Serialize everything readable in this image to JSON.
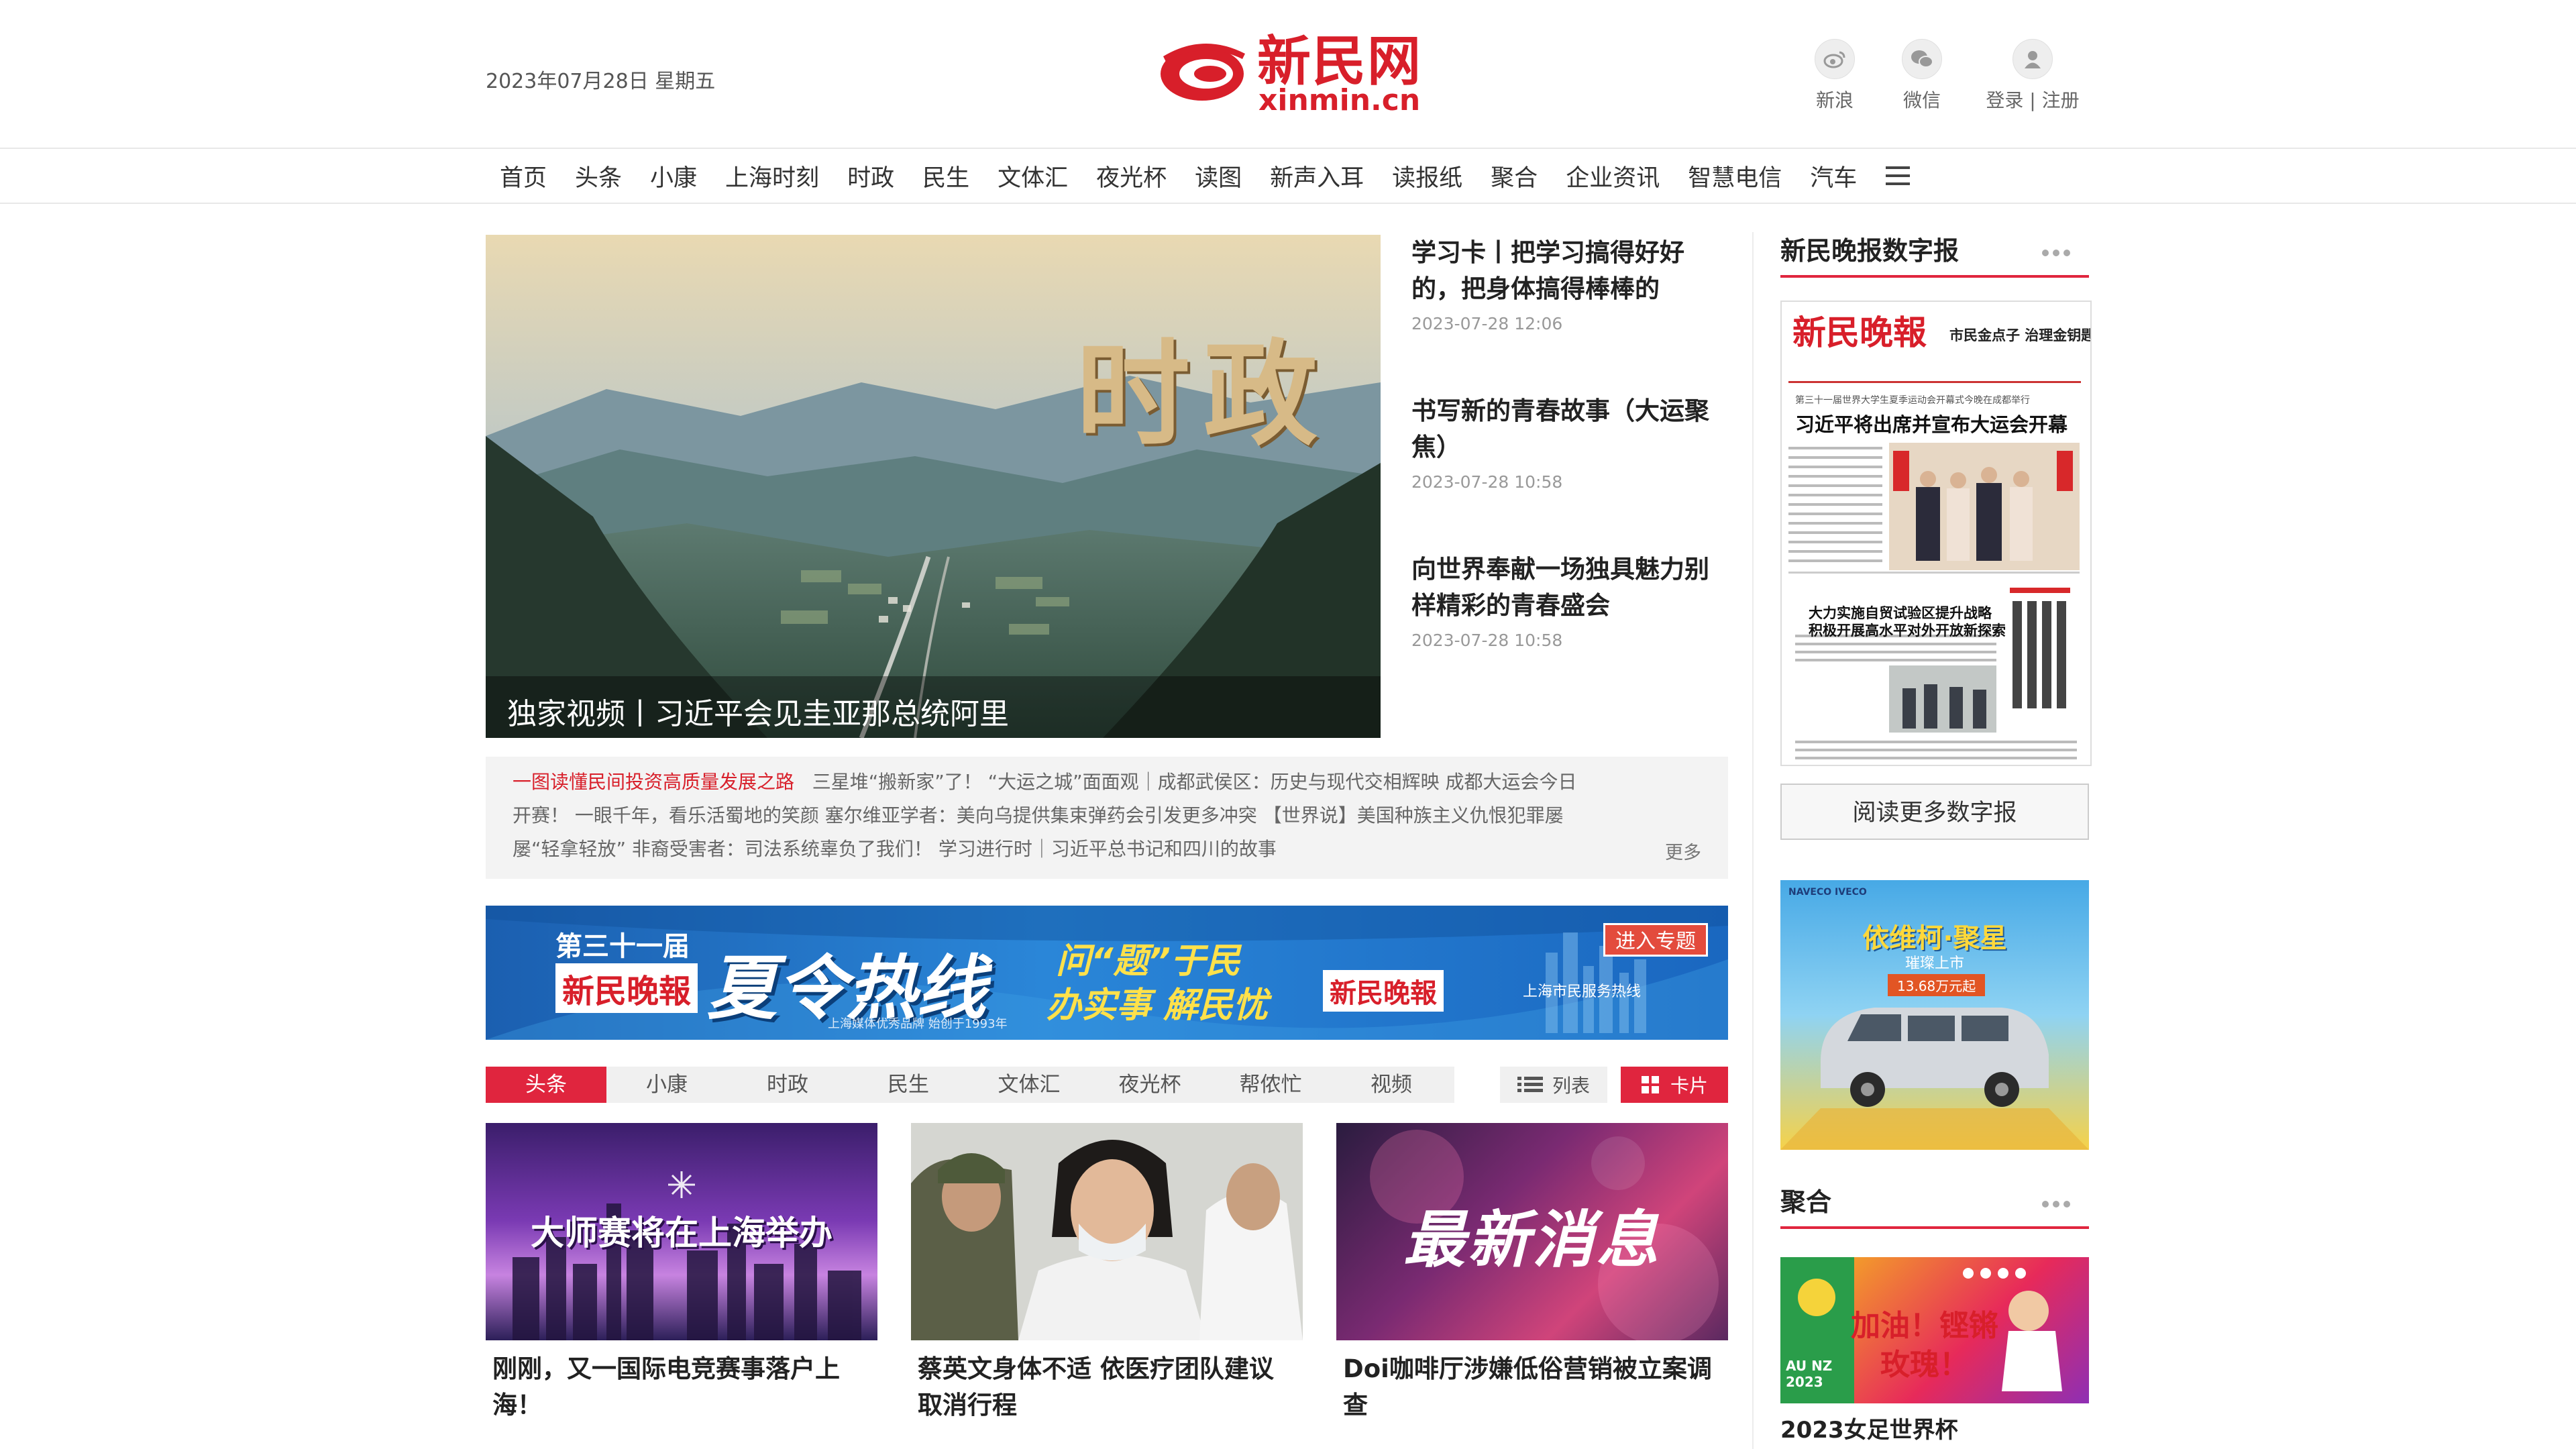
{
  "header": {
    "date": "2023年07月28日 星期五",
    "logo_cn": "新民网",
    "logo_en": "xinmin.cn",
    "tools": [
      {
        "icon": "weibo-icon",
        "label": "新浪"
      },
      {
        "icon": "wechat-icon",
        "label": "微信"
      },
      {
        "icon": "user-icon",
        "label": "登录 | 注册"
      }
    ]
  },
  "nav": [
    "首页",
    "头条",
    "小康",
    "上海时刻",
    "时政",
    "民生",
    "文体汇",
    "夜光杯",
    "读图",
    "新声入耳",
    "读报纸",
    "聚合",
    "企业资讯",
    "智慧电信",
    "汽车"
  ],
  "hero": {
    "overlay_text": "时政",
    "caption": "独家视频丨习近平会见圭亚那总统阿里"
  },
  "side_news": [
    {
      "title": "学习卡丨把学习搞得好好的，把身体搞得棒棒的",
      "date": "2023-07-28 12:06"
    },
    {
      "title": "书写新的青春故事（大运聚焦）",
      "date": "2023-07-28 10:58"
    },
    {
      "title": "向世界奉献一场独具魅力别样精彩的青春盛会",
      "date": "2023-07-28 10:58"
    }
  ],
  "ticker": {
    "highlight": "一图读懂民间投资高质量发展之路",
    "line1_rest": "三星堆“搬新家”了！  “大运之城”面面观｜成都武侯区：历史与现代交相辉映   成都大运会今日",
    "line2": "开赛！   一眼千年，看乐活蜀地的笑颜   塞尔维亚学者：美向乌提供集束弹药会引发更多冲突   【世界说】美国种族主义仇恨犯罪屡",
    "line3": "屡“轻拿轻放” 非裔受害者：司法系统辜负了我们！   学习进行时｜习近平总书记和四川的故事",
    "more": "更多"
  },
  "banner": {
    "edition": "第三十一届",
    "paper_name": "新民晚報",
    "title": "夏令热线",
    "slogan_top": "问“题”于民",
    "slogan_bottom": "办实事  解民忧",
    "paper_name_2": "新民晚報",
    "enter": "进入专题",
    "footnote": "上海媒体优秀品牌 始创于1993年",
    "hotline": "上海市民服务热线"
  },
  "tabs": [
    "头条",
    "小康",
    "时政",
    "民生",
    "文体汇",
    "夜光杯",
    "帮侬忙",
    "视频"
  ],
  "view_modes": {
    "list": "列表",
    "card": "卡片"
  },
  "cards": [
    {
      "image_text": "大师赛将在上海举办",
      "title": "刚刚，又一国际电竞赛事落户上海！"
    },
    {
      "image_text": "",
      "title": "蔡英文身体不适 依医疗团队建议取消行程"
    },
    {
      "image_text": "最新消息",
      "title": "Doi咖啡厅涉嫌低俗营销被立案调查"
    }
  ],
  "right": {
    "digital_title": "新民晚报数字报",
    "newspaper": {
      "masthead": "新民晚報",
      "side_headline": "市民金点子  治理金钥匙",
      "subhead": "第三十一届世界大学生夏季运动会开幕式今晚在成都举行",
      "headline": "习近平将出席并宣布大运会开幕",
      "headline2a": "大力实施自贸试验区提升战略",
      "headline2b": "积极开展高水平对外开放新探索"
    },
    "read_more": "阅读更多数字报",
    "ad": {
      "brands": "NAVECO  IVECO",
      "slogan": "依维柯·聚星",
      "sub": "璀璨上市",
      "price": "13.68万元起"
    },
    "juhe_title": "聚合",
    "juhe_image_text": "加油！铿锵玫瑰！",
    "juhe_badge": "AU NZ 2023",
    "juhe_caption": "2023女足世界杯"
  },
  "colors": {
    "accent": "#e0253e",
    "logo_red": "#d81f2a",
    "ticker_bg": "#f3f3f3"
  }
}
